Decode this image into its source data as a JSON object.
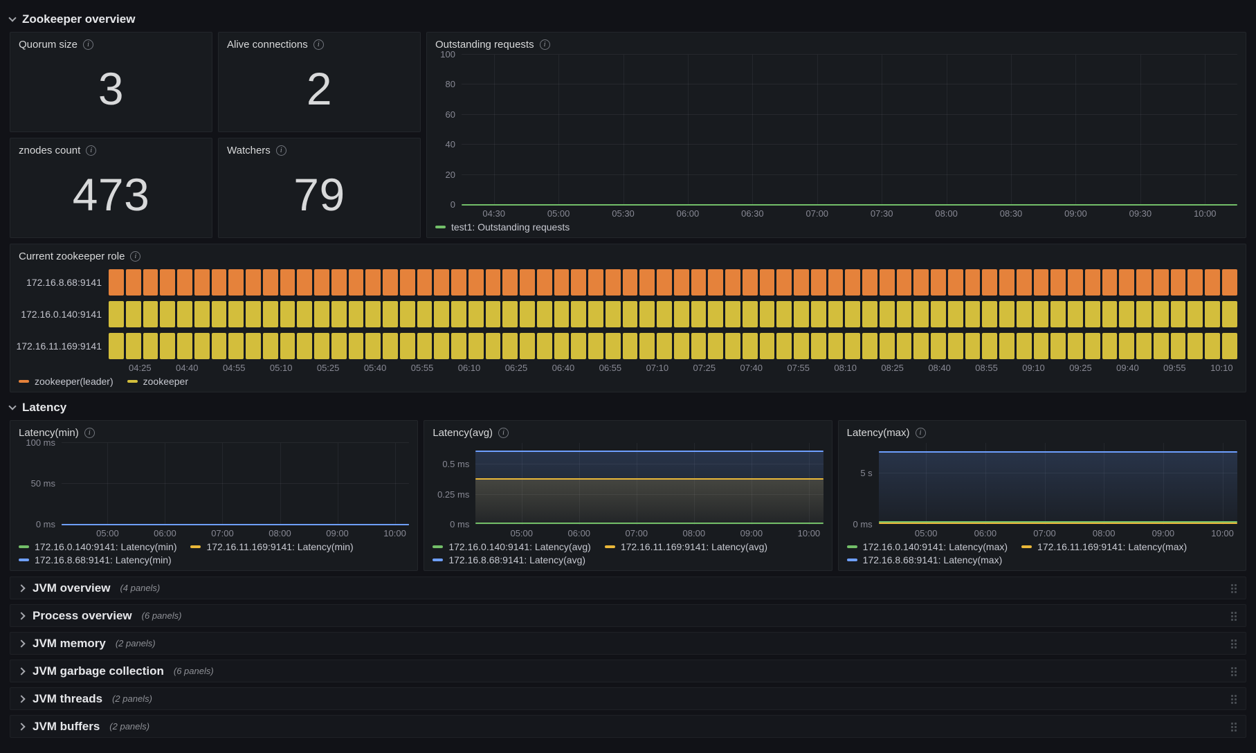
{
  "sections": {
    "zookeeper_overview": {
      "title": "Zookeeper overview"
    },
    "latency": {
      "title": "Latency"
    }
  },
  "stat_panels": [
    {
      "title": "Quorum size",
      "value": "3"
    },
    {
      "title": "Alive connections",
      "value": "2"
    },
    {
      "title": "znodes count",
      "value": "473"
    },
    {
      "title": "Watchers",
      "value": "79"
    }
  ],
  "collapsed_rows": [
    {
      "label": "JVM overview",
      "panels": "(4 panels)"
    },
    {
      "label": "Process overview",
      "panels": "(6 panels)"
    },
    {
      "label": "JVM memory",
      "panels": "(2 panels)"
    },
    {
      "label": "JVM garbage collection",
      "panels": "(6 panels)"
    },
    {
      "label": "JVM threads",
      "panels": "(2 panels)"
    },
    {
      "label": "JVM buffers",
      "panels": "(2 panels)"
    }
  ],
  "chart_data": [
    {
      "id": "outstanding_requests",
      "type": "line",
      "title": "Outstanding requests",
      "x_range": [
        "04:15",
        "10:15"
      ],
      "x_ticks": [
        "04:30",
        "05:00",
        "05:30",
        "06:00",
        "06:30",
        "07:00",
        "07:30",
        "08:00",
        "08:30",
        "09:00",
        "09:30",
        "10:00"
      ],
      "ylim": [
        0,
        100
      ],
      "y_ticks": [
        {
          "label": "0",
          "value": 0
        },
        {
          "label": "20",
          "value": 20
        },
        {
          "label": "40",
          "value": 40
        },
        {
          "label": "60",
          "value": 60
        },
        {
          "label": "80",
          "value": 80
        },
        {
          "label": "100",
          "value": 100
        }
      ],
      "grid": true,
      "legend_position": "bottom-left",
      "series": [
        {
          "name": "test1: Outstanding requests",
          "color": "#73BF69",
          "value": 0,
          "fill": false
        }
      ]
    },
    {
      "id": "current_role",
      "type": "state-timeline",
      "title": "Current zookeeper role",
      "x_range": [
        "04:15",
        "10:15"
      ],
      "x_ticks": [
        "04:25",
        "04:40",
        "04:55",
        "05:10",
        "05:25",
        "05:40",
        "05:55",
        "06:10",
        "06:25",
        "06:40",
        "06:55",
        "07:10",
        "07:25",
        "07:40",
        "07:55",
        "08:10",
        "08:25",
        "08:40",
        "08:55",
        "09:10",
        "09:25",
        "09:40",
        "09:55",
        "10:10"
      ],
      "points": 66,
      "rows": [
        {
          "label": "172.16.8.68:9141",
          "state": "zookeeper(leader)",
          "color": "#E5823B"
        },
        {
          "label": "172.16.0.140:9141",
          "state": "zookeeper",
          "color": "#D3BE3C"
        },
        {
          "label": "172.16.11.169:9141",
          "state": "zookeeper",
          "color": "#D3BE3C"
        }
      ],
      "legend": [
        {
          "label": "zookeeper(leader)",
          "color": "#E5823B"
        },
        {
          "label": "zookeeper",
          "color": "#D3BE3C"
        }
      ]
    },
    {
      "id": "latency_min",
      "type": "line",
      "title": "Latency(min)",
      "x_range": [
        "04:12",
        "10:15"
      ],
      "x_ticks": [
        "05:00",
        "06:00",
        "07:00",
        "08:00",
        "09:00",
        "10:00"
      ],
      "ylim": [
        0,
        100
      ],
      "unit": "ms",
      "y_ticks": [
        {
          "label": "0 ms",
          "value": 0
        },
        {
          "label": "50 ms",
          "value": 50
        },
        {
          "label": "100 ms",
          "value": 100
        }
      ],
      "grid": true,
      "legend_position": "bottom-left",
      "series": [
        {
          "name": "172.16.0.140:9141: Latency(min)",
          "color": "#73BF69",
          "value": 0,
          "fill": false
        },
        {
          "name": "172.16.11.169:9141: Latency(min)",
          "color": "#EAB839",
          "value": 0,
          "fill": false
        },
        {
          "name": "172.16.8.68:9141: Latency(min)",
          "color": "#6E9FFF",
          "value": 0,
          "fill": false
        }
      ]
    },
    {
      "id": "latency_avg",
      "type": "line",
      "title": "Latency(avg)",
      "x_range": [
        "04:12",
        "10:15"
      ],
      "x_ticks": [
        "05:00",
        "06:00",
        "07:00",
        "08:00",
        "09:00",
        "10:00"
      ],
      "ylim": [
        0,
        0.68
      ],
      "unit": "ms",
      "y_ticks": [
        {
          "label": "0 ms",
          "value": 0
        },
        {
          "label": "0.25 ms",
          "value": 0.25
        },
        {
          "label": "0.5 ms",
          "value": 0.5
        }
      ],
      "grid": true,
      "legend_position": "bottom-left",
      "series": [
        {
          "name": "172.16.0.140:9141: Latency(avg)",
          "color": "#73BF69",
          "value": 0.01,
          "fill": false
        },
        {
          "name": "172.16.11.169:9141: Latency(avg)",
          "color": "#EAB839",
          "value": 0.38,
          "fill": true
        },
        {
          "name": "172.16.8.68:9141: Latency(avg)",
          "color": "#6E9FFF",
          "value": 0.61,
          "fill": true
        }
      ]
    },
    {
      "id": "latency_max",
      "type": "line",
      "title": "Latency(max)",
      "x_range": [
        "04:12",
        "10:15"
      ],
      "x_ticks": [
        "05:00",
        "06:00",
        "07:00",
        "08:00",
        "09:00",
        "10:00"
      ],
      "ylim": [
        0,
        8
      ],
      "unit": "s",
      "y_ticks": [
        {
          "label": "0 ms",
          "value": 0
        },
        {
          "label": "5 s",
          "value": 5
        }
      ],
      "grid": true,
      "legend_position": "bottom-left",
      "series": [
        {
          "name": "172.16.0.140:9141: Latency(max)",
          "color": "#73BF69",
          "value": 0.25,
          "fill": false
        },
        {
          "name": "172.16.11.169:9141: Latency(max)",
          "color": "#EAB839",
          "value": 0.12,
          "fill": false
        },
        {
          "name": "172.16.8.68:9141: Latency(max)",
          "color": "#6E9FFF",
          "value": 7.1,
          "fill": true
        }
      ]
    }
  ]
}
